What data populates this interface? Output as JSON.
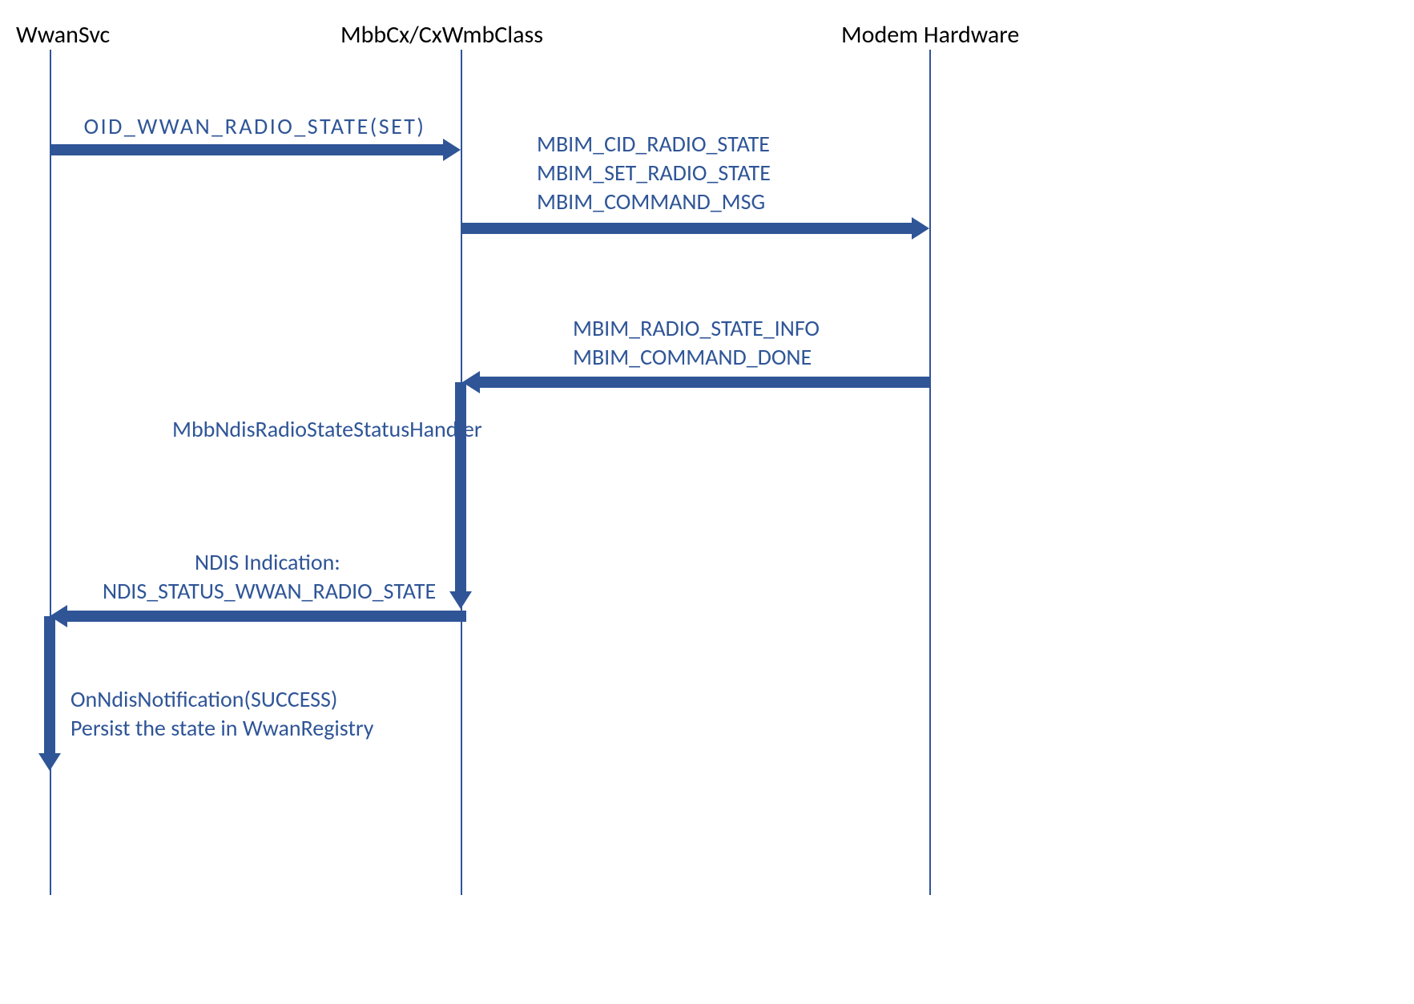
{
  "participants": {
    "wwansvc": "WwanSvc",
    "mbbcx": "MbbCx/CxWmbClass",
    "modem": "Modem Hardware"
  },
  "messages": {
    "oid_set": "OID_WWAN_RADIO_STATE(SET)",
    "mbim_cmd_l1": "MBIM_CID_RADIO_STATE",
    "mbim_cmd_l2": "MBIM_SET_RADIO_STATE",
    "mbim_cmd_l3": "MBIM_COMMAND_MSG",
    "mbim_done_l1": "MBIM_RADIO_STATE_INFO",
    "mbim_done_l2": "MBIM_COMMAND_DONE",
    "handler": "MbbNdisRadioStateStatusHandler",
    "ndis_ind_l1": "NDIS Indication:",
    "ndis_ind_l2": "NDIS_STATUS_WWAN_RADIO_STATE",
    "notify_l1": "OnNdisNotification(SUCCESS)",
    "notify_l2": "Persist the state in WwanRegistry"
  },
  "colors": {
    "line": "#2f5597",
    "arrow": "#2f5597",
    "text": "#2f5597",
    "participant_text": "#000000"
  }
}
